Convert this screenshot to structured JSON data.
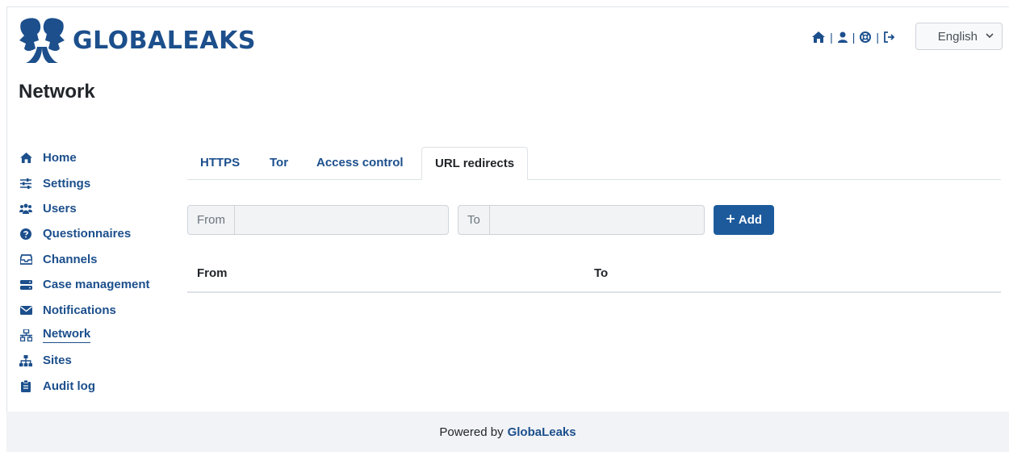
{
  "brand": {
    "name": "GLOBALEAKS"
  },
  "page": {
    "title": "Network"
  },
  "topbar": {
    "icons": [
      "home-icon",
      "user-icon",
      "support-icon",
      "logout-icon"
    ],
    "language": "English"
  },
  "sidebar": {
    "items": [
      {
        "label": "Home",
        "icon": "home-icon"
      },
      {
        "label": "Settings",
        "icon": "sliders-icon"
      },
      {
        "label": "Users",
        "icon": "users-icon"
      },
      {
        "label": "Questionnaires",
        "icon": "question-circle-icon"
      },
      {
        "label": "Channels",
        "icon": "inbox-icon"
      },
      {
        "label": "Case management",
        "icon": "server-icon"
      },
      {
        "label": "Notifications",
        "icon": "envelope-icon"
      },
      {
        "label": "Network",
        "icon": "network-icon"
      },
      {
        "label": "Sites",
        "icon": "sitemap-icon"
      },
      {
        "label": "Audit log",
        "icon": "clipboard-icon"
      }
    ],
    "active": "Network"
  },
  "tabs": [
    {
      "label": "HTTPS"
    },
    {
      "label": "Tor"
    },
    {
      "label": "Access control"
    },
    {
      "label": "URL redirects"
    }
  ],
  "active_tab": "URL redirects",
  "form": {
    "from_label": "From",
    "from_value": "",
    "to_label": "To",
    "to_value": "",
    "add_label": "Add"
  },
  "table": {
    "headers": [
      "From",
      "To"
    ],
    "rows": []
  },
  "footer": {
    "prefix": "Powered by",
    "link": "GlobaLeaks"
  },
  "colors": {
    "brand": "#1c4f8c",
    "button": "#1c5a9c",
    "footer_bg": "#f1f3f6"
  }
}
